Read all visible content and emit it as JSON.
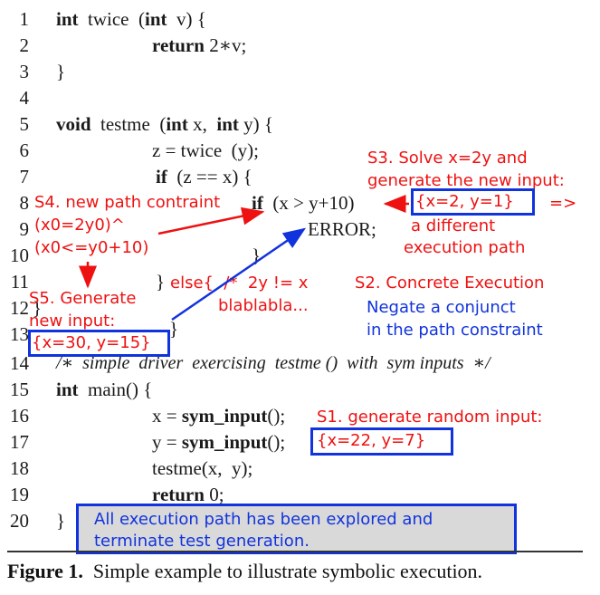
{
  "code": {
    "line_numbers": [
      "1",
      "2",
      "3",
      "4",
      "5",
      "6",
      "7",
      "8",
      "9",
      "10",
      "11",
      "12",
      "13",
      "14",
      "15",
      "16",
      "17",
      "18",
      "19",
      "20"
    ],
    "l1_kw": "int",
    "l1_a": "twice",
    "l1_b": "(",
    "l1_kw2": "int",
    "l1_c": "v) {",
    "l2_kw": "return",
    "l2_a": "2∗v;",
    "l3": "}",
    "l5_kw": "void",
    "l5_a": "testme",
    "l5_b": "(",
    "l5_kw2": "int",
    "l5_c": "x,",
    "l5_kw3": "int",
    "l5_d": "y) {",
    "l6": "z = twice  (y);",
    "l7_kw": "if",
    "l7_a": "(z == x) {",
    "l8_kw": "if",
    "l8_a": "(x > y+10)",
    "l9": "ERROR;",
    "l10": "}",
    "l11": "}",
    "l12": "}",
    "l13": "}",
    "l14": "/∗  simple  driver  exercising  testme ()  with  sym inputs  ∗/",
    "l15_kw": "int",
    "l15_a": "main() {",
    "l16_a": "x = ",
    "l16_kw": "sym_input",
    "l16_b": "();",
    "l17_a": "y = ",
    "l17_kw": "sym_input",
    "l17_b": "();",
    "l18": "testme(x,  y);",
    "l19_kw": "return",
    "l19_a": "0;",
    "l20": "}"
  },
  "annotations": {
    "s1_label": "S1. generate random input:",
    "s1_value": "{x=22, y=7}",
    "s2_label": "S2. Concrete Execution",
    "s2_note_1": "Negate a conjunct",
    "s2_note_2": "in the path constraint",
    "s3_line1": "S3. Solve x=2y and",
    "s3_line2": "generate the new input:",
    "s3_value": "{x=2, y=1}",
    "s3_arrow": "=>",
    "s3_note1": "a different",
    "s3_note2": "execution path",
    "s4_line1": "S4. new path contraint",
    "s4_line2": "(x0=2y0)^",
    "s4_line3": "(x0<=y0+10)",
    "s5_line1": "S5. Generate",
    "s5_line2": "new input:",
    "s5_value": "{x=30, y=15}",
    "else_line1": "else{  /*  2y != x",
    "else_line2": "blablabla...",
    "final_line1": "All execution path has been explored and",
    "final_line2": "terminate test generation."
  },
  "caption": {
    "label": "Figure 1.",
    "text": "Simple example to illustrate symbolic execution."
  },
  "colors": {
    "annotation_red": "#ee1111",
    "annotation_blue": "#1133dd",
    "final_box_fill": "#d9d9d9"
  }
}
